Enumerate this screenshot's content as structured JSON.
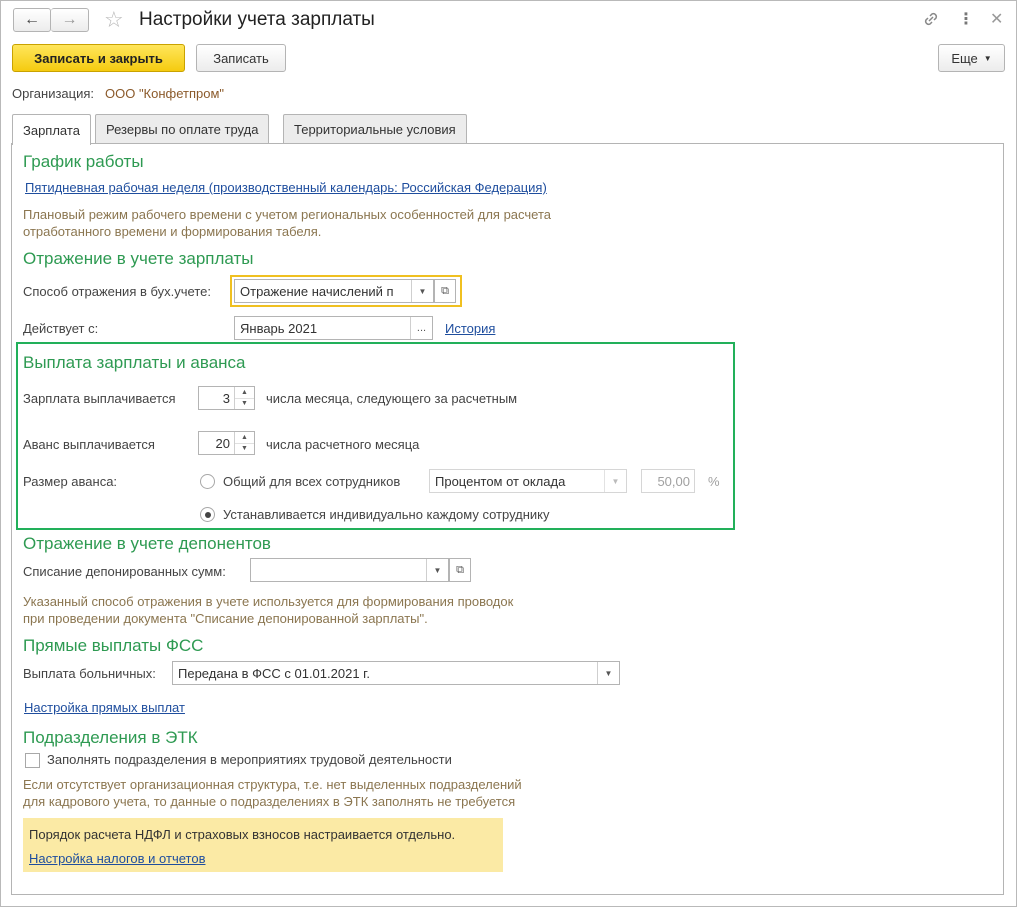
{
  "window": {
    "title": "Настройки учета зарплаты",
    "more_label": "Еще"
  },
  "toolbar": {
    "save_close_label": "Записать и закрыть",
    "save_label": "Записать"
  },
  "organization": {
    "label": "Организация:",
    "value": "ООО \"Конфетпром\""
  },
  "tabs": [
    {
      "label": "Зарплата",
      "active": true
    },
    {
      "label": "Резервы по оплате труда",
      "active": false
    },
    {
      "label": "Территориальные условия",
      "active": false
    }
  ],
  "schedule": {
    "heading": "График работы",
    "link": "Пятидневная рабочая неделя (производственный календарь: Российская Федерация)",
    "hint_line1": "Плановый режим рабочего времени с учетом региональных особенностей для расчета",
    "hint_line2": "отработанного времени и формирования табеля."
  },
  "accounting": {
    "heading": "Отражение в учете зарплаты",
    "method_label": "Способ отражения в бух.учете:",
    "method_value": "Отражение начислений п",
    "effective_label": "Действует с:",
    "effective_value": "Январь 2021",
    "history_link": "История"
  },
  "payment": {
    "heading": "Выплата зарплаты и аванса",
    "salary_label": "Зарплата выплачивается",
    "salary_day": "3",
    "salary_suffix": "числа месяца, следующего за расчетным",
    "advance_label": "Аванс выплачивается",
    "advance_day": "20",
    "advance_suffix": "числа расчетного месяца",
    "advance_size_label": "Размер аванса:",
    "option_common": "Общий для всех сотрудников",
    "common_method": "Процентом от оклада",
    "common_percent": "50,00",
    "percent_sign": "%",
    "option_individual": "Устанавливается индивидуально каждому сотруднику",
    "selected_option": "individual"
  },
  "deponents": {
    "heading": "Отражение в учете депонентов",
    "writeoff_label": "Списание депонированных сумм:",
    "writeoff_value": "",
    "hint_line1": "Указанный способ отражения в учете используется для формирования проводок",
    "hint_line2": "при проведении документа \"Списание депонированной зарплаты\"."
  },
  "fss": {
    "heading": "Прямые выплаты ФСС",
    "sick_label": "Выплата больничных:",
    "sick_value": "Передана в ФСС с 01.01.2021 г.",
    "settings_link": "Настройка прямых выплат"
  },
  "etk": {
    "heading": "Подразделения в ЭТК",
    "checkbox_label": "Заполнять подразделения в мероприятиях трудовой деятельности",
    "checked": false,
    "hint_line1": "Если отсутствует организационная структура, т.е. нет выделенных подразделений",
    "hint_line2": "для кадрового учета, то данные о подразделениях в ЭТК заполнять не требуется"
  },
  "notice": {
    "text": "Порядок расчета НДФЛ и страховых взносов настраивается отдельно.",
    "link": "Настройка налогов и отчетов"
  },
  "colors": {
    "section_heading": "#2e9a52",
    "hint_text": "#8b7650",
    "link": "#1f4e9e",
    "primary_button": "#f5cb10",
    "highlight_frame": "#22b05a",
    "focus_frame": "#f0c020",
    "notice_bg": "#fbeaa5"
  },
  "icons": [
    "back-arrow-icon",
    "forward-arrow-icon",
    "star-icon",
    "link-icon",
    "kebab-menu-icon",
    "close-icon",
    "dropdown-arrow-icon",
    "open-form-icon",
    "spin-up-icon",
    "spin-down-icon"
  ]
}
